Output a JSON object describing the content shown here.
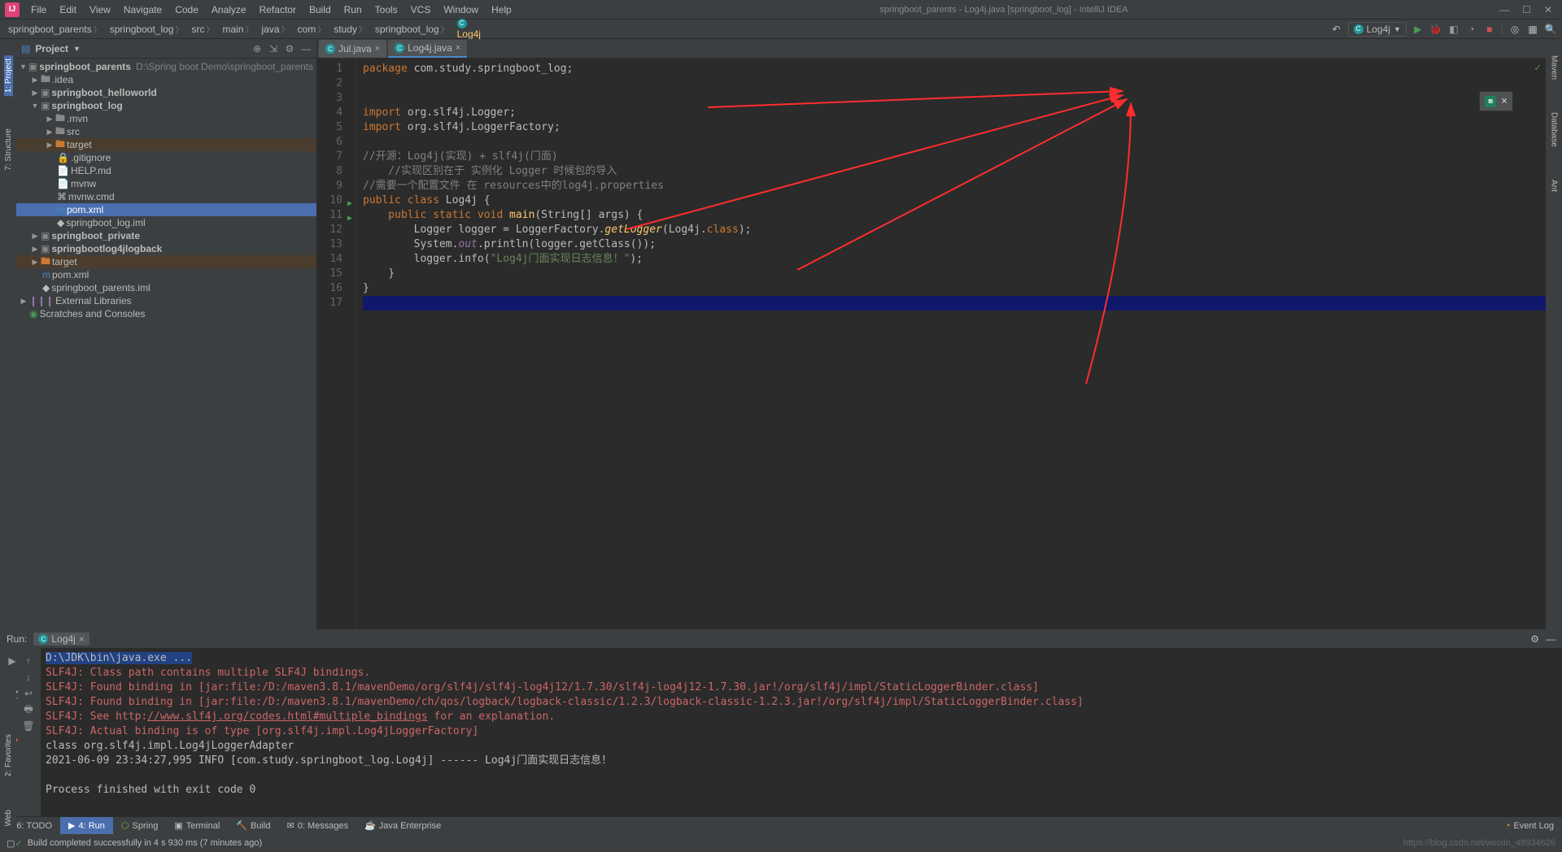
{
  "window": {
    "title": "springboot_parents - Log4j.java [springboot_log] - IntelliJ IDEA"
  },
  "menu": [
    "File",
    "Edit",
    "View",
    "Navigate",
    "Code",
    "Analyze",
    "Refactor",
    "Build",
    "Run",
    "Tools",
    "VCS",
    "Window",
    "Help"
  ],
  "breadcrumb": [
    "springboot_parents",
    "springboot_log",
    "src",
    "main",
    "java",
    "com",
    "study",
    "springboot_log",
    "Log4j"
  ],
  "run_config": {
    "name": "Log4j"
  },
  "left_tools": [
    "1: Project",
    "7: Structure"
  ],
  "right_tools": [
    "Maven",
    "Database",
    "Ant"
  ],
  "project_panel": {
    "title": "Project"
  },
  "tree": {
    "root": {
      "name": "springboot_parents",
      "path": "D:\\Spring boot  Demo\\springboot_parents"
    },
    "idea": {
      "name": ".idea"
    },
    "hello": {
      "name": "springboot_helloworld"
    },
    "log": {
      "name": "springboot_log"
    },
    "mvn": {
      "name": ".mvn"
    },
    "src": {
      "name": "src"
    },
    "target": {
      "name": "target"
    },
    "gitignore": {
      "name": ".gitignore"
    },
    "help": {
      "name": "HELP.md"
    },
    "mvnw": {
      "name": "mvnw"
    },
    "mvnwcmd": {
      "name": "mvnw.cmd"
    },
    "pom": {
      "name": "pom.xml"
    },
    "iml": {
      "name": "springboot_log.iml"
    },
    "private": {
      "name": "springboot_private"
    },
    "logback": {
      "name": "springbootlog4jlogback"
    },
    "target2": {
      "name": "target"
    },
    "pom2": {
      "name": "pom.xml"
    },
    "iml2": {
      "name": "springboot_parents.iml"
    },
    "extlib": {
      "name": "External Libraries"
    },
    "scratch": {
      "name": "Scratches and Consoles"
    }
  },
  "editor_tabs": [
    {
      "name": "Jul.java"
    },
    {
      "name": "Log4j.java"
    }
  ],
  "code": {
    "l1": "package com.study.springboot_log;",
    "l4": "import org.slf4j.Logger;",
    "l5": "import org.slf4j.LoggerFactory;",
    "l7": "//开源：Log4j(实现) + slf4j(门面)",
    "l8": "    //实现区别在于 实例化 Logger 时候包的导入",
    "l9": "//需要一个配置文件 在 resources中的log4j.properties",
    "l10a": "public class ",
    "l10b": "Log4j",
    "l10c": " {",
    "l11a": "    public static void ",
    "l11b": "main",
    "l11c": "(String[] args) {",
    "l12a": "        Logger logger = LoggerFactory.",
    "l12b": "getLogger",
    "l12c": "(Log4j.",
    "l12d": "class",
    "l12e": ");",
    "l13a": "        System.",
    "l13b": "out",
    "l13c": ".println(logger.getClass());",
    "l14a": "        logger.info(",
    "l14str": "\"Log4j门面实现日志信息！\"",
    "l14c": ");",
    "l15": "    }",
    "l16": "}"
  },
  "run_panel": {
    "label": "Run:",
    "tab": "Log4j"
  },
  "console": {
    "l1": "D:\\JDK\\bin\\java.exe ...",
    "l2": "SLF4J: Class path contains multiple SLF4J bindings.",
    "l3": "SLF4J: Found binding in [jar:file:/D:/maven3.8.1/mavenDemo/org/slf4j/slf4j-log4j12/1.7.30/slf4j-log4j12-1.7.30.jar!/org/slf4j/impl/StaticLoggerBinder.class]",
    "l4": "SLF4J: Found binding in [jar:file:/D:/maven3.8.1/mavenDemo/ch/qos/logback/logback-classic/1.2.3/logback-classic-1.2.3.jar!/org/slf4j/impl/StaticLoggerBinder.class]",
    "l5a": "SLF4J: See http:",
    "l5link": "//www.slf4j.org/codes.html#multiple_bindings",
    "l5b": " for an explanation.",
    "l6": "SLF4J: Actual binding is of type [org.slf4j.impl.Log4jLoggerFactory]",
    "l7": "class org.slf4j.impl.Log4jLoggerAdapter",
    "l8": "2021-06-09 23:34:27,995 INFO [com.study.springboot_log.Log4j] ------ Log4j门面实现日志信息！",
    "l10": "Process finished with exit code 0"
  },
  "bottom_tabs": {
    "todo": "6: TODO",
    "run": "4: Run",
    "spring": "Spring",
    "terminal": "Terminal",
    "build": "Build",
    "messages": "0: Messages",
    "javaee": "Java Enterprise",
    "eventlog": "Event Log"
  },
  "status": {
    "msg": "Build completed successfully in 4 s 930 ms (7 minutes ago)",
    "watermark": "https://blog.csdn.net/weixin_48934626"
  },
  "left_tool_favorites": "2: Favorites",
  "left_tool_web": "Web"
}
